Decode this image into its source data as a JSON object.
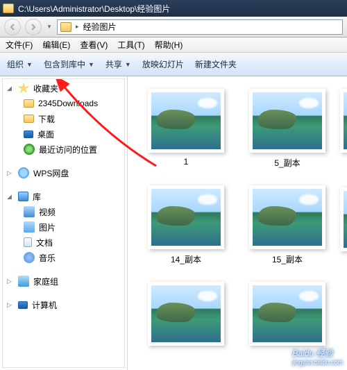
{
  "title_path": "C:\\Users\\Administrator\\Desktop\\经验图片",
  "address_current": "经验图片",
  "menus": {
    "file": "文件(F)",
    "edit": "编辑(E)",
    "view": "查看(V)",
    "tools": "工具(T)",
    "help": "帮助(H)"
  },
  "toolbar": {
    "organize": "组织",
    "include": "包含到库中",
    "share": "共享",
    "slideshow": "放映幻灯片",
    "newfolder": "新建文件夹"
  },
  "sidebar": {
    "favorites": "收藏夹",
    "fav_items": {
      "downloads2345": "2345Downloads",
      "downloads": "下载",
      "desktop": "桌面",
      "recent": "最近访问的位置"
    },
    "wps": "WPS网盘",
    "libraries": "库",
    "lib_items": {
      "video": "视频",
      "pictures": "图片",
      "documents": "文档",
      "music": "音乐"
    },
    "homegroup": "家庭组",
    "computer_partial": "计算机"
  },
  "files": {
    "f1": "1",
    "f2": "5_副本",
    "f3": "14_副本",
    "f4": "15_副本"
  },
  "watermark": {
    "brand": "Baidu 经验",
    "url": "jingyan.baidu.com"
  }
}
